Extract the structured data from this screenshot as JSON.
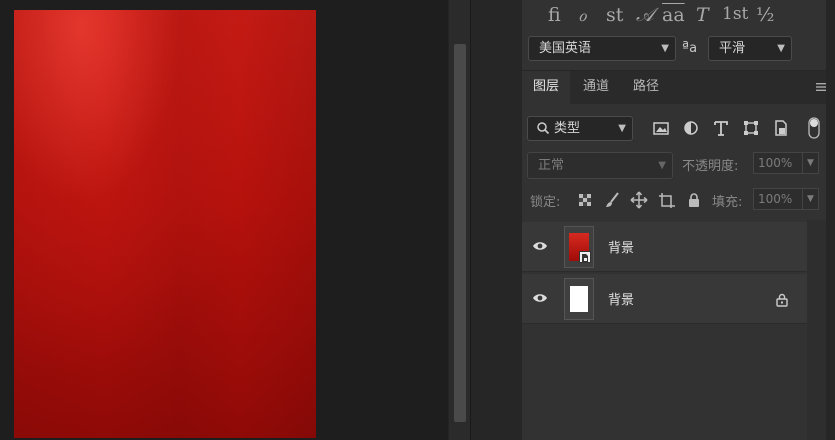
{
  "glyphs": [
    "ﬁ",
    "ℴ",
    "st",
    "𝒜",
    "aa",
    "𝑇",
    "1st",
    "½"
  ],
  "character": {
    "language": "美国英语",
    "antialias_icon": "aa-size-icon",
    "antialias": "平滑"
  },
  "tabs": [
    {
      "label": "图层",
      "active": true
    },
    {
      "label": "通道",
      "active": false
    },
    {
      "label": "路径",
      "active": false
    }
  ],
  "filter": {
    "kind": "类型"
  },
  "blend": {
    "mode": "正常",
    "opacity_label": "不透明度:",
    "opacity": "100%"
  },
  "lock": {
    "label": "锁定:",
    "fill_label": "填充:",
    "fill": "100%"
  },
  "layers": [
    {
      "name": "背景",
      "thumb": "red-gradient",
      "locked": false,
      "smart_object": true
    },
    {
      "name": "背景",
      "thumb": "white",
      "locked": true,
      "smart_object": false
    }
  ],
  "colors": {
    "accent_red": "#b5110c",
    "panel_bg": "#323232",
    "workspace_bg": "#1e1e1e"
  }
}
